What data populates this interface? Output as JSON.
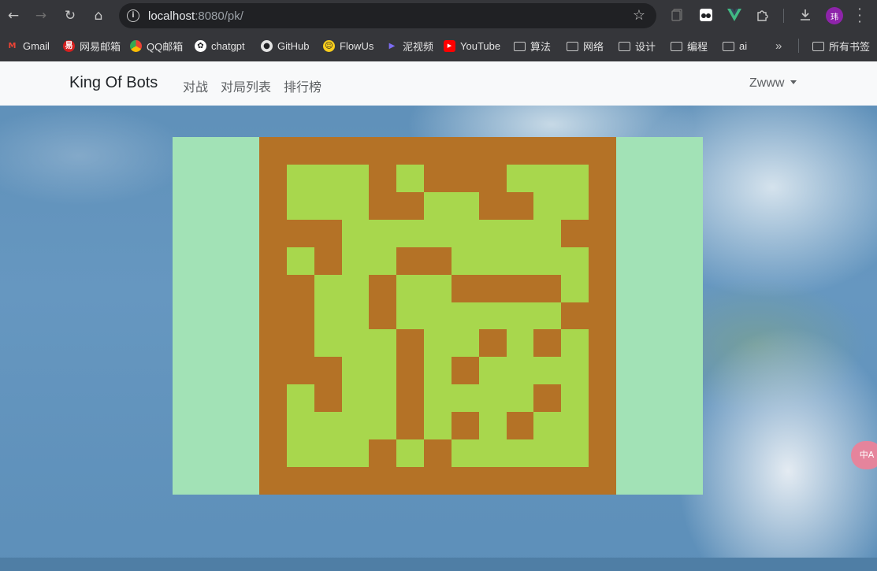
{
  "browser": {
    "url_host": "localhost",
    "url_rest": ":8080/pk/",
    "avatar_text": "玮",
    "bookmarks": [
      {
        "label": "Gmail",
        "icon": "gmail-icon",
        "color": "#ea4335"
      },
      {
        "label": "网易邮箱",
        "icon": "netease-mail-icon",
        "color": "#d6201f"
      },
      {
        "label": "QQ邮箱",
        "icon": "qq-mail-icon",
        "color": "#f4b400"
      },
      {
        "label": "chatgpt",
        "icon": "chatgpt-icon",
        "color": "#ffffff"
      },
      {
        "label": "GitHub",
        "icon": "github-icon",
        "color": "#ffffff"
      },
      {
        "label": "FlowUs",
        "icon": "flowus-icon",
        "color": "#f9ce1d"
      },
      {
        "label": "泥视频",
        "icon": "play-icon",
        "color": "#7c6cf2"
      },
      {
        "label": "YouTube",
        "icon": "youtube-icon",
        "color": "#ff0000"
      },
      {
        "label": "算法",
        "icon": "folder-icon"
      },
      {
        "label": "网络",
        "icon": "folder-icon"
      },
      {
        "label": "设计",
        "icon": "folder-icon"
      },
      {
        "label": "编程",
        "icon": "folder-icon"
      },
      {
        "label": "ai",
        "icon": "folder-icon"
      }
    ],
    "overflow_label": "»",
    "all_bookmarks_label": "所有书签"
  },
  "app": {
    "brand": "King Of Bots",
    "nav_links": [
      "对战",
      "对局列表",
      "排行榜"
    ],
    "username": "Zwww",
    "translate_label": "中A"
  },
  "colors": {
    "wall": "#b47226",
    "grass": "#a8d74d",
    "map_bg": "#a2e2b6",
    "navbar_bg": "#f8f9fa"
  },
  "game_map": {
    "rows": 13,
    "cols": 13,
    "grid": [
      "1111111111111",
      "1000101110001",
      "1000110011001",
      "1110000000011",
      "1010011000001",
      "1100100111101",
      "1100100000011",
      "1100010010101",
      "1110010100001",
      "1010010000101",
      "1000010101001",
      "1000101000001",
      "1111111111111"
    ]
  }
}
